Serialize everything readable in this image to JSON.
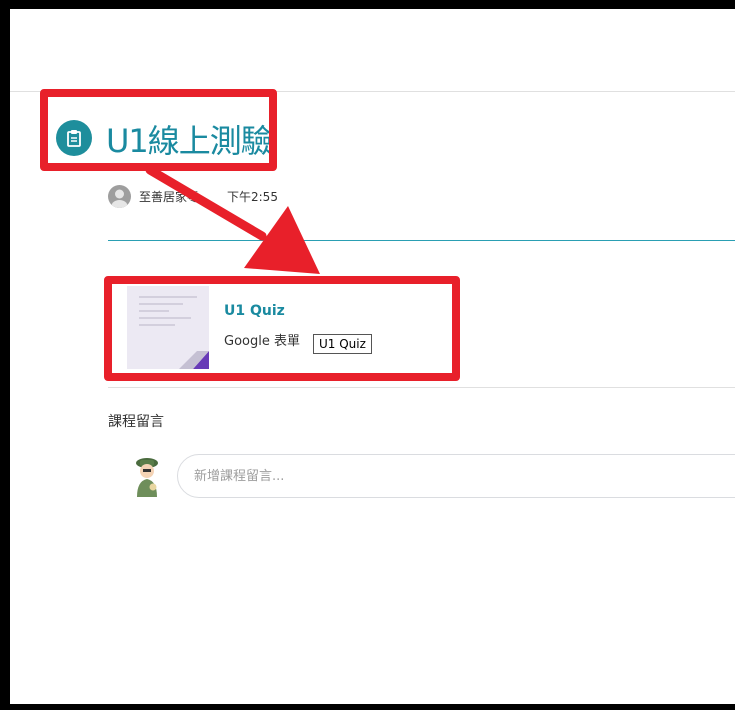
{
  "post": {
    "title": "U1線上測驗",
    "author": "至善居家零",
    "time": "下午2:55"
  },
  "attachment": {
    "title": "U1 Quiz",
    "type": "Google 表單",
    "tooltip": "U1 Quiz"
  },
  "comments": {
    "label": "課程留言",
    "placeholder": "新增課程留言..."
  },
  "colors": {
    "accent": "#1a8aa0",
    "highlight": "#e8202a",
    "forms_purple": "#673ab7"
  },
  "icons": {
    "title_icon": "assignment-icon",
    "author_avatar": "default-avatar-icon",
    "user_avatar": "cartoon-avatar-icon"
  }
}
